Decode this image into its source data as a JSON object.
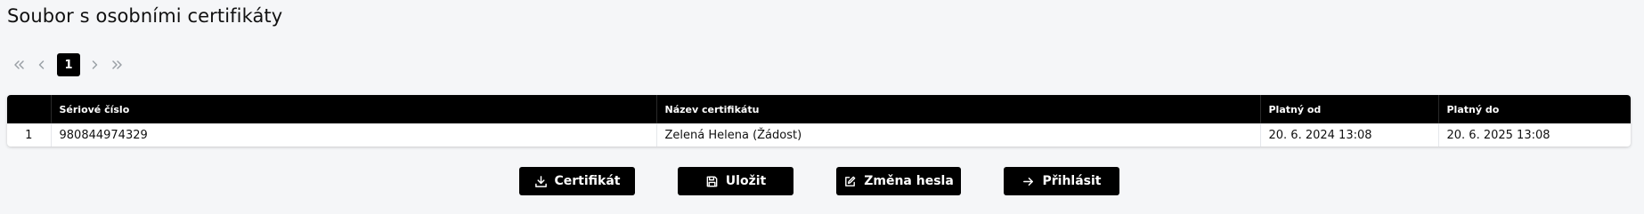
{
  "page": {
    "title": "Soubor s osobními certifikáty"
  },
  "pagination": {
    "current_page": "1"
  },
  "table": {
    "columns": [
      "",
      "Sériové číslo",
      "Název certifikátu",
      "Platný od",
      "Platný do"
    ],
    "rows": [
      {
        "index": "1",
        "serial": "980844974329",
        "name": "Zelená Helena (Žádost)",
        "valid_from": "20. 6. 2024 13:08",
        "valid_to": "20. 6. 2025 13:08"
      }
    ]
  },
  "actions": {
    "certificate_label": "Certifikát",
    "save_label": "Uložit",
    "change_password_label": "Změna hesla",
    "login_label": "Přihlásit"
  },
  "icons": {
    "first_page": "double-chevron-left-icon",
    "prev_page": "chevron-left-icon",
    "next_page": "chevron-right-icon",
    "last_page": "double-chevron-right-icon",
    "certificate": "download-icon",
    "save": "floppy-disk-icon",
    "change_password": "edit-icon",
    "login": "arrow-right-icon"
  },
  "colors": {
    "page_background": "#f5f6f8",
    "accent": "#000000",
    "pager_disabled": "#9aa0a6"
  }
}
